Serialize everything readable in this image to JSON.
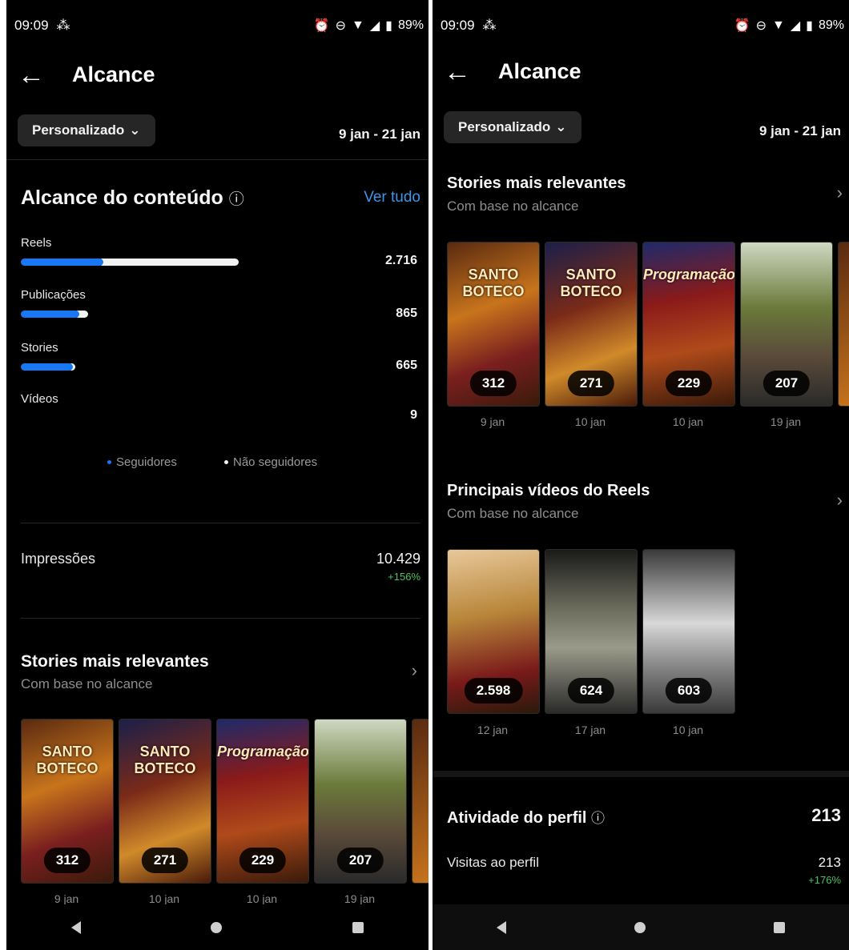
{
  "left": {
    "status": {
      "time": "09:09",
      "battery": "89%"
    },
    "title": "Alcance",
    "filter": {
      "label": "Personalizado"
    },
    "date_range": "9 jan - 21 jan",
    "reach": {
      "heading": "Alcance do conteúdo",
      "see_all": "Ver tudo",
      "rows": [
        {
          "label": "Reels",
          "value": "2.716",
          "followers_pct": 0.38,
          "non_followers_pct": 0.62
        },
        {
          "label": "Publicações",
          "value": "865",
          "followers_pct": 0.27,
          "non_followers_pct": 0.04
        },
        {
          "label": "Stories",
          "value": "665",
          "followers_pct": 0.24,
          "non_followers_pct": 0.01
        },
        {
          "label": "Vídeos",
          "value": "9",
          "followers_pct": 0.0,
          "non_followers_pct": 0.0
        }
      ],
      "legend": {
        "followers": "Seguidores",
        "non_followers": "Não seguidores"
      },
      "colors": {
        "followers": "#1877f2",
        "non_followers": "#f2f2f2"
      }
    },
    "impressions": {
      "label": "Impressões",
      "value": "10.429",
      "delta": "+156%"
    },
    "stories": {
      "heading": "Stories mais relevantes",
      "subtitle": "Com base no alcance",
      "items": [
        {
          "count": "312",
          "date": "9 jan",
          "overlay": "SANTO BOTECO"
        },
        {
          "count": "271",
          "date": "10 jan",
          "overlay": "SANTO BOTECO"
        },
        {
          "count": "229",
          "date": "10 jan",
          "overlay": "Programação"
        },
        {
          "count": "207",
          "date": "19 jan",
          "overlay": ""
        }
      ]
    }
  },
  "right": {
    "status": {
      "time": "09:09",
      "battery": "89%"
    },
    "title": "Alcance",
    "filter": {
      "label": "Personalizado"
    },
    "date_range": "9 jan - 21 jan",
    "stories": {
      "heading": "Stories mais relevantes",
      "subtitle": "Com base no alcance",
      "items": [
        {
          "count": "312",
          "date": "9 jan",
          "overlay": "SANTO BOTECO"
        },
        {
          "count": "271",
          "date": "10 jan",
          "overlay": "SANTO BOTECO"
        },
        {
          "count": "229",
          "date": "10 jan",
          "overlay": "Programação"
        },
        {
          "count": "207",
          "date": "19 jan",
          "overlay": ""
        }
      ]
    },
    "reels": {
      "heading": "Principais vídeos do Reels",
      "subtitle": "Com base no alcance",
      "items": [
        {
          "count": "2.598",
          "date": "12 jan"
        },
        {
          "count": "624",
          "date": "17 jan"
        },
        {
          "count": "603",
          "date": "10 jan"
        }
      ]
    },
    "activity": {
      "heading": "Atividade do perfil",
      "total": "213",
      "visits_label": "Visitas ao perfil",
      "visits_value": "213",
      "visits_delta": "+176%"
    }
  }
}
